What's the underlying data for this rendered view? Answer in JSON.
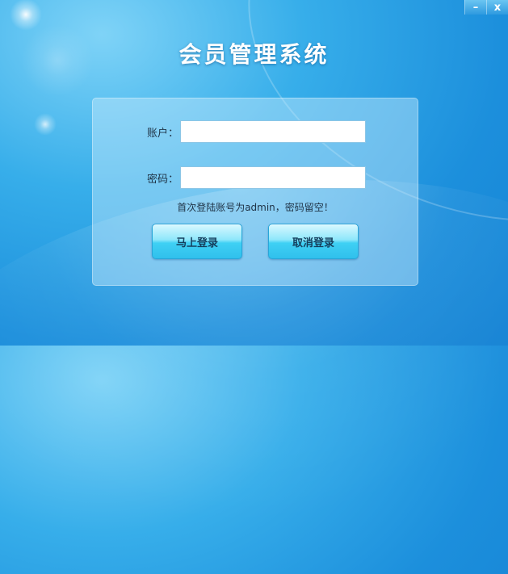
{
  "window": {
    "minimize_label": "–",
    "close_label": "x"
  },
  "header": {
    "title": "会员管理系统"
  },
  "form": {
    "account_label": "账户：",
    "account_value": "",
    "password_label": "密码：",
    "password_value": "",
    "hint": "首次登陆账号为admin，密码留空！",
    "login_button": "马上登录",
    "cancel_button": "取消登录"
  }
}
